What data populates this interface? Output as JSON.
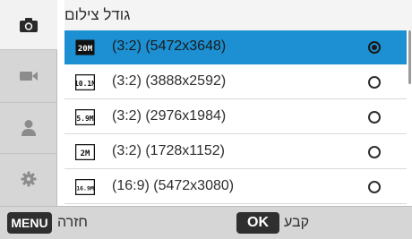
{
  "title": "גודל צילום",
  "tabs": [
    {
      "icon": "camera-icon",
      "active": true
    },
    {
      "icon": "video-camera-icon",
      "active": false
    },
    {
      "icon": "user-icon",
      "active": false
    },
    {
      "icon": "settings-gear-icon",
      "active": false
    }
  ],
  "options": [
    {
      "icon_text": "20M",
      "label": "(3:2) (5472x3648)",
      "selected": true
    },
    {
      "icon_text": "10.1M",
      "label": "(3:2) (3888x2592)",
      "selected": false
    },
    {
      "icon_text": "5.9M",
      "label": "(3:2) (2976x1984)",
      "selected": false
    },
    {
      "icon_text": "2M",
      "label": "(3:2) (1728x1152)",
      "selected": false
    },
    {
      "icon_text": "16.9M",
      "label": "(16:9) (5472x3080)",
      "selected": false
    }
  ],
  "footer": {
    "menu_key": "MENU",
    "back_label": "חזרה",
    "ok_key": "OK",
    "set_label": "קבע"
  },
  "colors": {
    "selection": "#1c90d2",
    "rail": "#d6d6d6",
    "key": "#2f2f2f"
  }
}
